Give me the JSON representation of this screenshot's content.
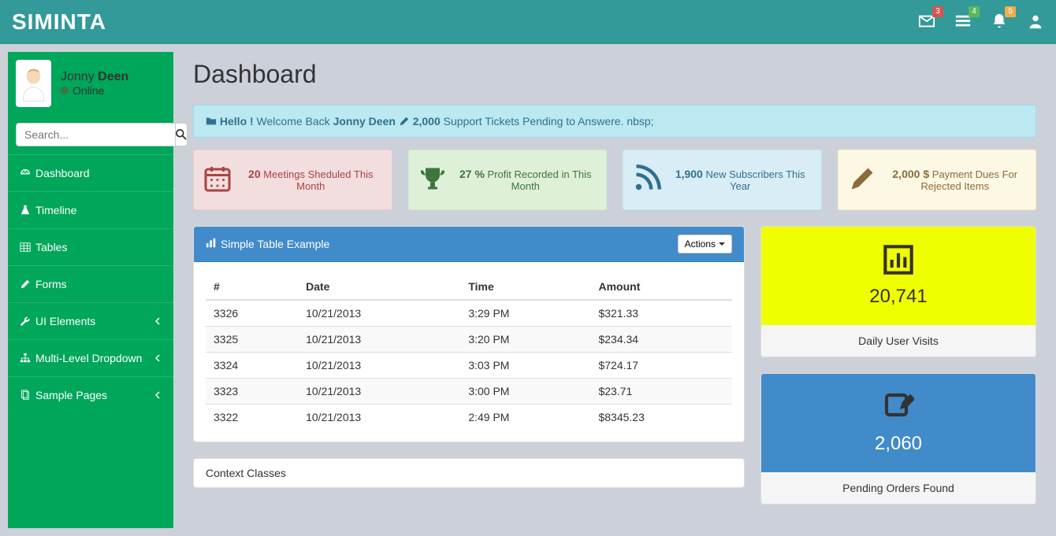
{
  "brand": "SIMINTA",
  "nav_badges": {
    "mail": "3",
    "tasks": "4",
    "bell": "5"
  },
  "user": {
    "first": "Jonny",
    "last": "Deen",
    "status": "Online"
  },
  "search": {
    "placeholder": "Search..."
  },
  "menu": [
    {
      "label": "Dashboard",
      "icon": "dashboard",
      "chevron": false
    },
    {
      "label": "Timeline",
      "icon": "flask",
      "chevron": false
    },
    {
      "label": "Tables",
      "icon": "table",
      "chevron": false
    },
    {
      "label": "Forms",
      "icon": "edit",
      "chevron": false
    },
    {
      "label": "UI Elements",
      "icon": "wrench",
      "chevron": true
    },
    {
      "label": "Multi-Level Dropdown",
      "icon": "sitemap",
      "chevron": true
    },
    {
      "label": "Sample Pages",
      "icon": "files",
      "chevron": true
    }
  ],
  "page_title": "Dashboard",
  "alert": {
    "hello": "Hello !",
    "welcome_pre": " Welcome Back ",
    "name": "Jonny Deen",
    "tickets": "2,000",
    "tickets_text": " Support Tickets Pending to Answere. nbsp;"
  },
  "cards": [
    {
      "num": "20",
      "text": " Meetings Sheduled This Month",
      "cls": "card-red",
      "icon": "calendar",
      "color": "#A94442"
    },
    {
      "num": "27 %",
      "text": " Profit Recorded in This Month",
      "cls": "card-green",
      "icon": "trophy",
      "color": "#3C763D"
    },
    {
      "num": "1,900",
      "text": " New Subscribers This Year",
      "cls": "card-blue",
      "icon": "rss",
      "color": "#31708F"
    },
    {
      "num": "2,000 $",
      "text": " Payment Dues For Rejected Items",
      "cls": "card-yellow",
      "icon": "pencil",
      "color": "#8A6D3B"
    }
  ],
  "table": {
    "title": "Simple Table Example",
    "actions_label": "Actions ",
    "headers": [
      "#",
      "Date",
      "Time",
      "Amount"
    ],
    "rows": [
      [
        "3326",
        "10/21/2013",
        "3:29 PM",
        "$321.33"
      ],
      [
        "3325",
        "10/21/2013",
        "3:20 PM",
        "$234.34"
      ],
      [
        "3324",
        "10/21/2013",
        "3:03 PM",
        "$724.17"
      ],
      [
        "3323",
        "10/21/2013",
        "3:00 PM",
        "$23.71"
      ],
      [
        "3322",
        "10/21/2013",
        "2:49 PM",
        "$8345.23"
      ]
    ]
  },
  "stats": [
    {
      "num": "20,741",
      "label": "Daily User Visits",
      "cls": "stat-yellow",
      "icon": "bar-chart"
    },
    {
      "num": "2,060",
      "label": "Pending Orders Found",
      "cls": "stat-blue",
      "icon": "edit-box"
    }
  ],
  "context_title": "Context Classes"
}
